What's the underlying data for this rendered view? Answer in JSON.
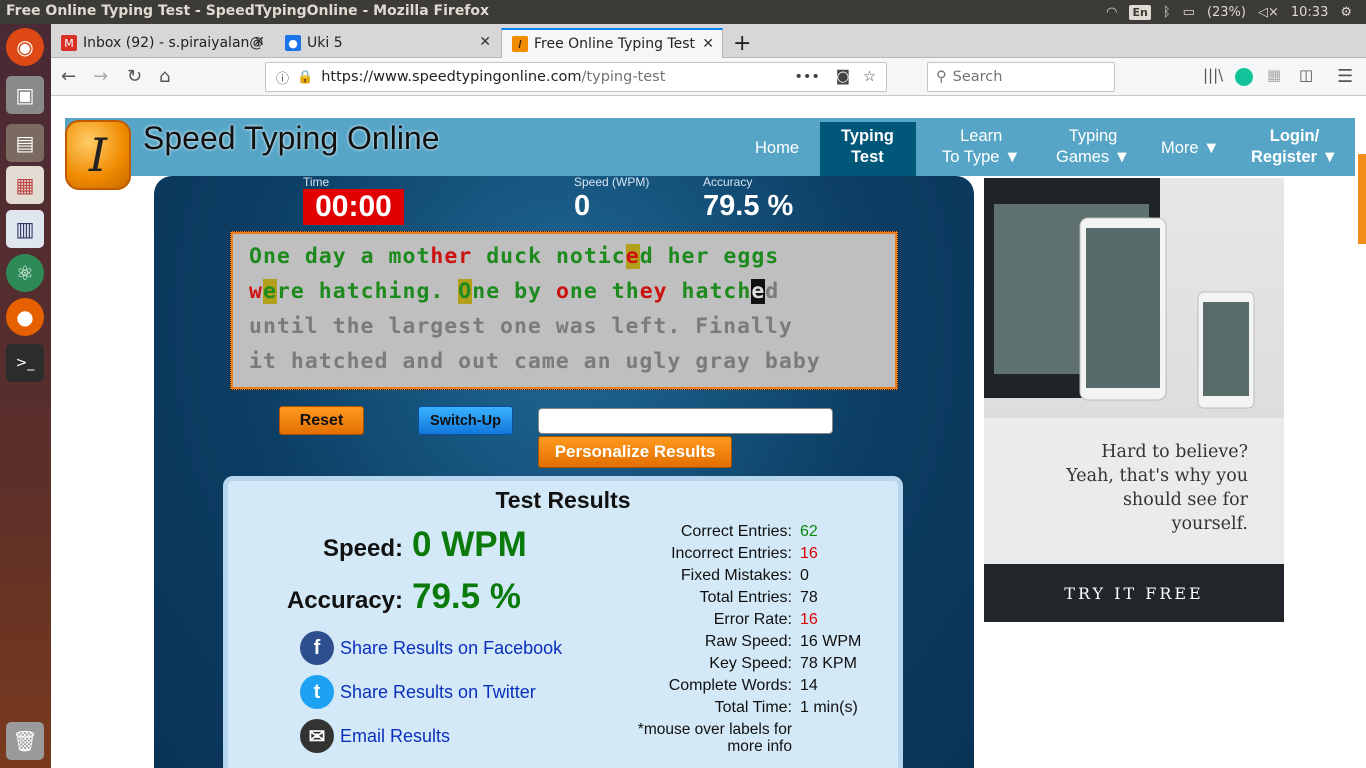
{
  "window": {
    "title": "Free Online Typing Test - SpeedTypingOnline - Mozilla Firefox",
    "lang": "En",
    "battery": "(23%)",
    "clock": "10:33"
  },
  "tabs": [
    {
      "label": "Inbox (92) - s.piraiyalan@"
    },
    {
      "label": "Uki 5"
    },
    {
      "label": "Free Online Typing Test"
    }
  ],
  "url": {
    "host": "https://www.speedtypingonline.com",
    "path": "/typing-test"
  },
  "search": {
    "placeholder": "Search"
  },
  "site": {
    "brand": "Speed Typing Online",
    "logo_letter": "I"
  },
  "nav": [
    {
      "l1": "Home",
      "l2": ""
    },
    {
      "l1": "Typing",
      "l2": "Test"
    },
    {
      "l1": "Learn",
      "l2": "To Type ▼"
    },
    {
      "l1": "Typing",
      "l2": "Games ▼"
    },
    {
      "l1": "More ▼",
      "l2": ""
    },
    {
      "l1": "Login/",
      "l2": "Register ▼"
    }
  ],
  "stats_bar": {
    "time_label": "Time",
    "time": "00:00",
    "speed_label": "Speed (WPM)",
    "speed": "0",
    "accuracy_label": "Accuracy",
    "accuracy": "79.5 %"
  },
  "passage": [
    "One day a mother duck noticed her eggs",
    "were hatching. One by one they hatched",
    "until the largest one was left. Finally",
    "it hatched and out came an ugly gray baby"
  ],
  "buttons": {
    "reset": "Reset",
    "switch_up": "Switch-Up",
    "personalize": "Personalize Results"
  },
  "results": {
    "title": "Test Results",
    "speed_label": "Speed:",
    "speed": "0 WPM",
    "accuracy_label": "Accuracy:",
    "accuracy": "79.5 %",
    "stats": [
      {
        "label": "Correct Entries:",
        "value": "62",
        "color": "#0a8a0a"
      },
      {
        "label": "Incorrect Entries:",
        "value": "16",
        "color": "#dd0000"
      },
      {
        "label": "Fixed Mistakes:",
        "value": "0",
        "color": "#111111"
      },
      {
        "label": "Total Entries:",
        "value": "78",
        "color": "#111111"
      },
      {
        "label": "Error Rate:",
        "value": "16",
        "color": "#dd0000"
      },
      {
        "label": "Raw Speed:",
        "value": "16 WPM",
        "color": "#111111"
      },
      {
        "label": "Key Speed:",
        "value": "78 KPM",
        "color": "#111111"
      },
      {
        "label": "Complete Words:",
        "value": "14",
        "color": "#111111"
      },
      {
        "label": "Total Time:",
        "value": "1 min(s)",
        "color": "#111111"
      }
    ],
    "note1": "*mouse over labels for",
    "note2": "more info",
    "share": [
      {
        "label": "Share Results on Facebook",
        "icon": "facebook-icon"
      },
      {
        "label": "Share Results on Twitter",
        "icon": "twitter-icon"
      },
      {
        "label": "Email Results",
        "icon": "email-icon"
      }
    ]
  },
  "ad": {
    "line1": "Hard to believe?",
    "line2": "Yeah, that's why you",
    "line3": "should see for",
    "line4": "yourself.",
    "button": "TRY IT FREE"
  }
}
